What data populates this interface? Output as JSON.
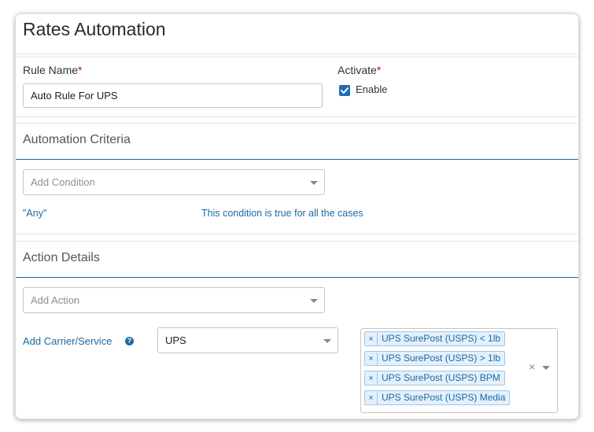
{
  "page": {
    "title": "Rates Automation"
  },
  "rule": {
    "name_label": "Rule Name",
    "required_mark": "*",
    "name_value": "Auto Rule For UPS",
    "activate_label": "Activate",
    "enable_label": "Enable",
    "enabled": true
  },
  "criteria": {
    "title": "Automation Criteria",
    "add_condition_placeholder": "Add Condition",
    "any_label": "\"Any\"",
    "any_description": "This condition is true for all the cases"
  },
  "action": {
    "title": "Action Details",
    "add_action_placeholder": "Add Action",
    "carrier_label": "Add Carrier/Service",
    "help_glyph": "?",
    "carrier_value": "UPS",
    "services": [
      "UPS SurePost (USPS) < 1lb",
      "UPS SurePost (USPS) > 1lb",
      "UPS SurePost (USPS) BPM",
      "UPS SurePost (USPS) Media"
    ],
    "remove_glyph": "×",
    "clear_glyph": "×"
  },
  "colors": {
    "accent": "#1a6aa3",
    "checkbox": "#1f6fb2",
    "required": "#d0021b",
    "tag_bg": "#e3f0fb"
  }
}
